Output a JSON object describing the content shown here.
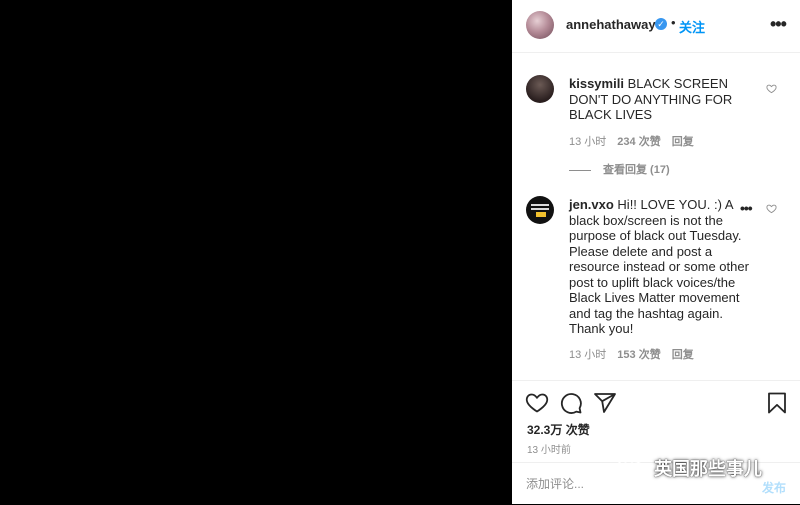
{
  "header": {
    "username": "annehathaway",
    "verified_glyph": "✓",
    "separator": "•",
    "follow_label": "关注",
    "more_label": "•••"
  },
  "comments": [
    {
      "username": "kissymili",
      "text": "BLACK SCREEN DON'T DO ANYTHING FOR BLACK LIVES",
      "time": "13 小时",
      "likes": "234 次赞",
      "reply_label": "回复",
      "view_replies": "查看回复 (17)"
    },
    {
      "username": "jen.vxo",
      "text": "Hi!! LOVE YOU. :) A black box/screen is not the purpose of black out Tuesday. Please delete and post a resource instead or some other post to uplift black voices/the Black Lives Matter movement and tag the hashtag again. Thank you!",
      "time": "13 小时",
      "likes": "153 次赞",
      "reply_label": "回复",
      "more_label": "•••"
    }
  ],
  "actions": {
    "icons": [
      "heart-icon",
      "comment-icon",
      "share-icon",
      "bookmark-icon"
    ],
    "likes_count": "32.3万 次赞",
    "time_ago": "13 小时前"
  },
  "add_comment": {
    "placeholder": "添加评论...",
    "post_label": "发布"
  },
  "watermark": {
    "text": "英国那些事儿"
  },
  "colors": {
    "accent": "#0095f6",
    "verified": "#3897f0",
    "muted": "#8e8e8e",
    "post_disabled": "#b2dffc"
  }
}
